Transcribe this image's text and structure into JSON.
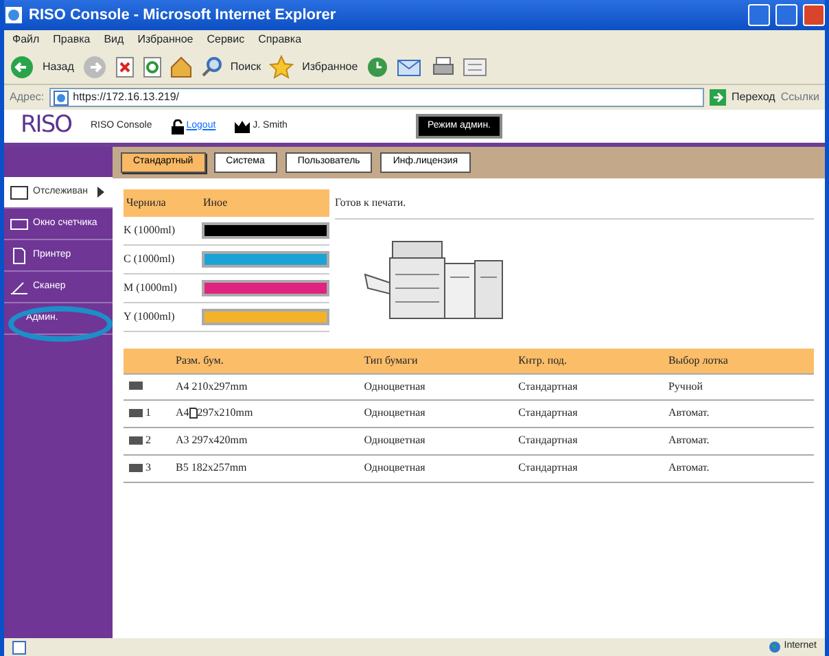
{
  "window": {
    "title": "RISO Console - Microsoft Internet Explorer"
  },
  "menu": [
    "Файл",
    "Правка",
    "Вид",
    "Избранное",
    "Сервис",
    "Справка"
  ],
  "toolbar": {
    "back": "Назад",
    "search": "Поиск",
    "favorites": "Избранное"
  },
  "address_bar": {
    "label": "Адрес:",
    "value": "https://172.16.13.219/",
    "go": "Переход",
    "links": "Ссылки"
  },
  "header": {
    "logo": "RISO",
    "app_name": "RISO Console",
    "logout": "Logout",
    "user": "J. Smith",
    "mode": "Режим админ."
  },
  "sidebar": {
    "items": [
      {
        "label": "Отслеживан",
        "selected": true
      },
      {
        "label": "Окно счетчика",
        "selected": false
      },
      {
        "label": "Принтер",
        "selected": false
      },
      {
        "label": "Сканер",
        "selected": false
      },
      {
        "label": "Админ.",
        "selected": false,
        "highlighted": true
      }
    ]
  },
  "tabs": [
    {
      "label": "Стандартный",
      "selected": true
    },
    {
      "label": "Система",
      "selected": false
    },
    {
      "label": "Пользователь",
      "selected": false
    },
    {
      "label": "Инф.лицензия",
      "selected": false
    }
  ],
  "inks": {
    "columns": [
      "Чернила",
      "Иное"
    ],
    "items": [
      {
        "name": "K (1000ml)",
        "color": "#000000",
        "level": 1
      },
      {
        "name": "C (1000ml)",
        "color": "#1ba3d6",
        "level": 1
      },
      {
        "name": "M (1000ml)",
        "color": "#e0237e",
        "level": 1
      },
      {
        "name": "Y (1000ml)",
        "color": "#f2b32a",
        "level": 1
      }
    ]
  },
  "status": "Готов к печати.",
  "trays": {
    "columns": [
      "Разм. бум.",
      "Тип бумаги",
      "Кнтр. под.",
      "Выбор лотка"
    ],
    "rows": [
      {
        "tray": "",
        "size": "A4 210x297mm",
        "rotated": false,
        "type": "Одноцветная",
        "control": "Стандартная",
        "select": "Ручной"
      },
      {
        "tray": "1",
        "size": "A4",
        "size_rest": "297x210mm",
        "rotated": true,
        "type": "Одноцветная",
        "control": "Стандартная",
        "select": "Автомат."
      },
      {
        "tray": "2",
        "size": "A3 297x420mm",
        "rotated": false,
        "type": "Одноцветная",
        "control": "Стандартная",
        "select": "Автомат."
      },
      {
        "tray": "3",
        "size": "B5 182x257mm",
        "rotated": false,
        "type": "Одноцветная",
        "control": "Стандартная",
        "select": "Автомат."
      }
    ]
  },
  "status_bar": {
    "zone": "Internet"
  }
}
